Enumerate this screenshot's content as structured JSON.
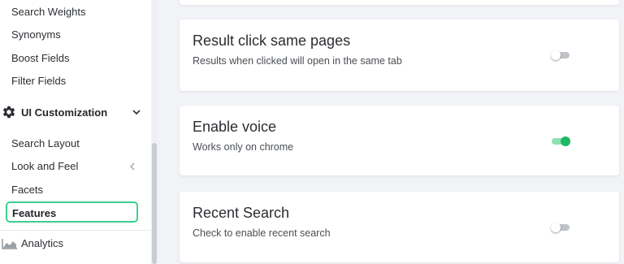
{
  "sidebar": {
    "items": [
      {
        "label": "Search Weights"
      },
      {
        "label": "Synonyms"
      },
      {
        "label": "Boost Fields"
      },
      {
        "label": "Filter Fields"
      }
    ],
    "group": {
      "label": "UI Customization",
      "icon": "gear-icon"
    },
    "sub_items": [
      {
        "label": "Search Layout"
      },
      {
        "label": "Look and Feel"
      },
      {
        "label": "Facets"
      },
      {
        "label": "Features"
      }
    ],
    "selected": "Features",
    "selected_border_color": "#3ecf8e",
    "analytics": {
      "label": "Analytics",
      "icon": "chart-icon"
    }
  },
  "main": {
    "cards": [
      {
        "title": "Result click same pages",
        "description": "Results when clicked will open in the same tab",
        "enabled": false
      },
      {
        "title": "Enable voice",
        "description": "Works only on chrome",
        "enabled": true
      },
      {
        "title": "Recent Search",
        "description": "Check to enable recent search",
        "enabled": false
      }
    ],
    "toggle_on_color": "#1fb866"
  }
}
